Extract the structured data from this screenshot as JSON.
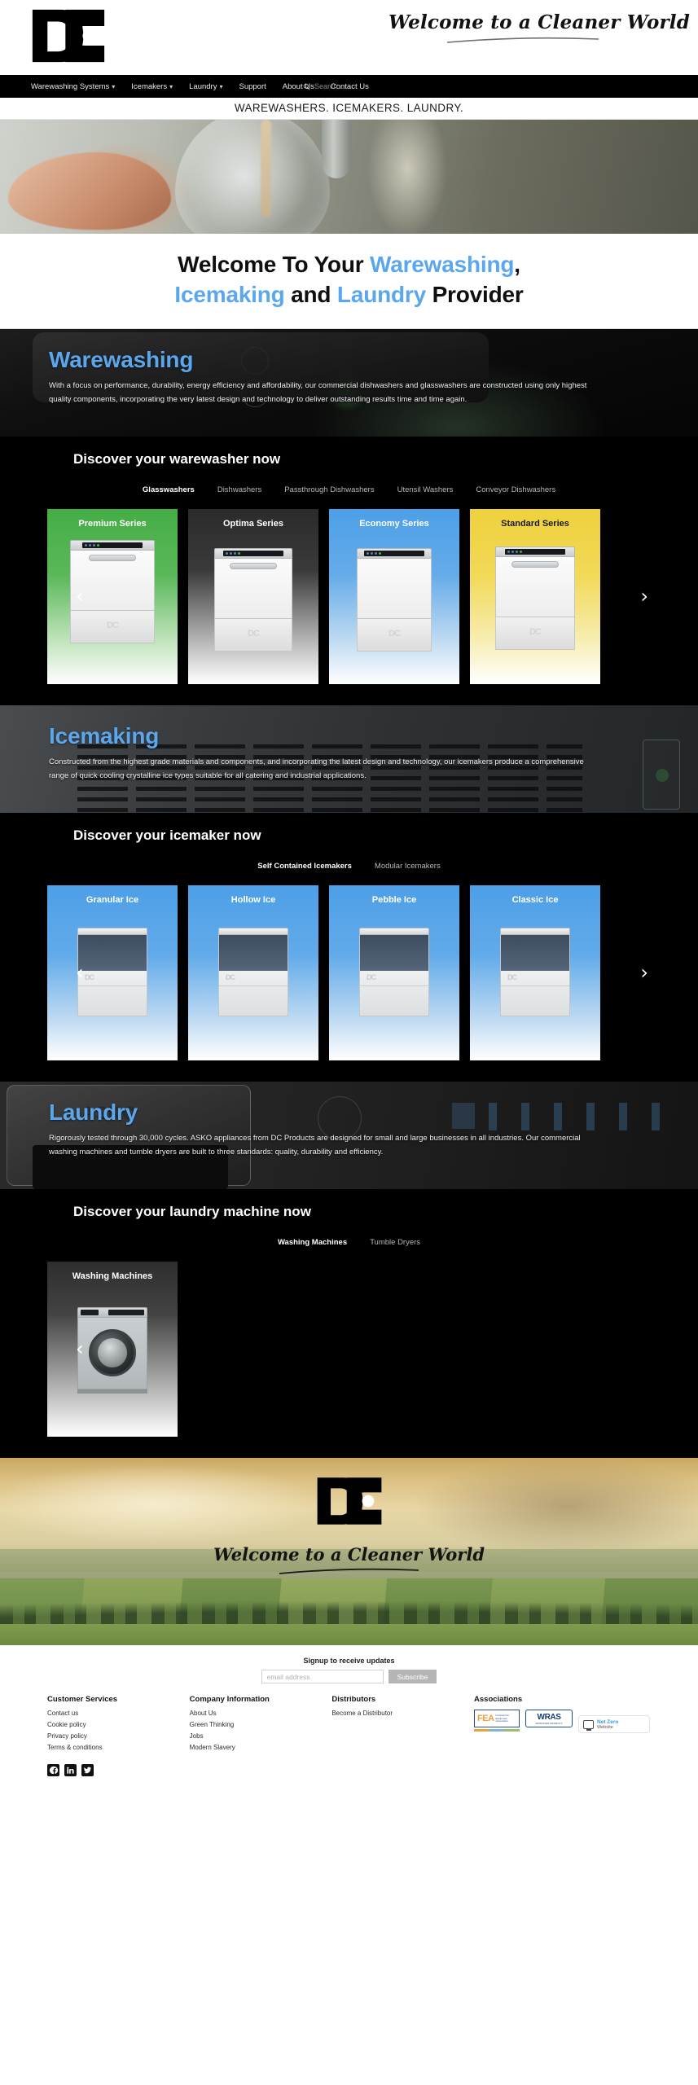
{
  "header": {
    "logo_alt": "DC logo",
    "tagline": "Welcome to a Cleaner World"
  },
  "nav": {
    "items": [
      {
        "label": "Warewashing Systems",
        "has_caret": true
      },
      {
        "label": "Icemakers",
        "has_caret": true
      },
      {
        "label": "Laundry",
        "has_caret": true
      },
      {
        "label": "Support",
        "has_caret": false
      },
      {
        "label": "About Us",
        "has_caret": false
      },
      {
        "label": "Contact Us",
        "has_caret": false
      }
    ],
    "search_placeholder": "Search...",
    "search_value": ""
  },
  "strapline": "WAREWASHERS. ICEMAKERS. LAUNDRY.",
  "welcome": {
    "line1_a": "Welcome To Your ",
    "line1_b": "Warewashing",
    "line1_c": ",",
    "line2_a": "Icemaking",
    "line2_b": " and ",
    "line2_c": "Laundry",
    "line2_d": " Provider",
    "accent_color": "#5aa7ee"
  },
  "warewashing": {
    "title": "Warewashing",
    "description": "With a focus on performance, durability, energy efficiency and affordability, our commercial dishwashers and glasswashers are constructed using only highest quality components, incorporating the very latest design and technology to deliver outstanding results time and time again.",
    "discover_heading": "Discover your warewasher now",
    "tabs": [
      {
        "label": "Glasswashers",
        "active": true
      },
      {
        "label": "Dishwashers",
        "active": false
      },
      {
        "label": "Passthrough Dishwashers",
        "active": false
      },
      {
        "label": "Utensil Washers",
        "active": false
      },
      {
        "label": "Conveyor Dishwashers",
        "active": false
      }
    ],
    "cards": [
      {
        "label": "Premium Series",
        "color": "#45ad45"
      },
      {
        "label": "Optima Series",
        "color": "#2b2b2b"
      },
      {
        "label": "Economy Series",
        "color": "#4d9fe8"
      },
      {
        "label": "Standard Series",
        "color": "#efd13d"
      }
    ],
    "prev_label": "‹",
    "next_label": "›"
  },
  "icemaking": {
    "title": "Icemaking",
    "description": "Constructed from the highest grade materials and components, and incorporating the latest design and technology, our icemakers produce a comprehensive range of quick cooling crystalline ice types suitable for all catering and industrial applications.",
    "discover_heading": "Discover your icemaker now",
    "tabs": [
      {
        "label": "Self Contained Icemakers",
        "active": true
      },
      {
        "label": "Modular Icemakers",
        "active": false
      }
    ],
    "cards": [
      {
        "label": "Granular Ice",
        "color": "#4d9fe8"
      },
      {
        "label": "Hollow Ice",
        "color": "#4d9fe8"
      },
      {
        "label": "Pebble Ice",
        "color": "#4d9fe8"
      },
      {
        "label": "Classic Ice",
        "color": "#4d9fe8"
      }
    ],
    "prev_label": "‹",
    "next_label": "›"
  },
  "laundry": {
    "title": "Laundry",
    "description": "Rigorously tested through 30,000 cycles. ASKO appliances from DC Products are designed for small and large businesses in all industries. Our commercial washing machines and tumble dryers are built to three standards: quality, durability and efficiency.",
    "discover_heading": "Discover your laundry machine now",
    "tabs": [
      {
        "label": "Washing Machines",
        "active": true
      },
      {
        "label": "Tumble Dryers",
        "active": false
      }
    ],
    "cards": [
      {
        "label": "Washing Machines",
        "color": "#2e2e2e"
      }
    ],
    "prev_label": "‹"
  },
  "footer_hero": {
    "logo_alt": "DC logo",
    "tagline": "Welcome to a Cleaner World"
  },
  "signup": {
    "title": "Signup to receive updates",
    "placeholder": "email address",
    "value": "",
    "button": "Subscribe"
  },
  "footer": {
    "columns": [
      {
        "heading": "Customer Services",
        "links": [
          "Contact us",
          "Cookie policy",
          "Privacy policy",
          "Terms & conditions"
        ]
      },
      {
        "heading": "Company Information",
        "links": [
          "About Us",
          "Green Thinking",
          "Jobs",
          "Modern Slavery"
        ]
      },
      {
        "heading": "Distributors",
        "links": [
          "Become a Distributor"
        ]
      }
    ],
    "associations_heading": "Associations",
    "badges": [
      {
        "name": "FEA",
        "main": "FEA",
        "sub": "Foodservice Equipment Association"
      },
      {
        "name": "WRAS",
        "main": "WRAS",
        "sub": "APPROVED PRODUCT"
      },
      {
        "name": "Net Zero Website",
        "main": "Net Zero",
        "sub": "Website"
      }
    ],
    "socials": [
      "facebook-icon",
      "linkedin-icon",
      "twitter-icon"
    ]
  }
}
